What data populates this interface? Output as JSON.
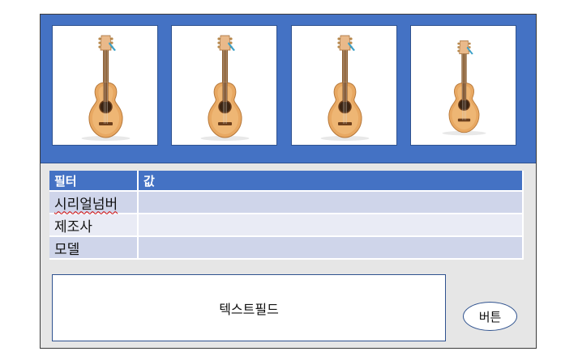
{
  "gallery": {
    "images": [
      {
        "icon": "guitar-image"
      },
      {
        "icon": "guitar-image"
      },
      {
        "icon": "guitar-image"
      },
      {
        "icon": "guitar-image"
      }
    ]
  },
  "table": {
    "headers": [
      "필터",
      "값"
    ],
    "rows": [
      {
        "filter": "시리얼넘버",
        "value": ""
      },
      {
        "filter": "제조사",
        "value": ""
      },
      {
        "filter": "모델",
        "value": ""
      }
    ]
  },
  "textfield": {
    "label": "텍스트필드"
  },
  "button": {
    "label": "버튼"
  },
  "colors": {
    "accent": "#4472c4",
    "row_odd": "#cfd5ea",
    "row_even": "#e9ebf5",
    "frame_bg": "#e6e6e6"
  }
}
